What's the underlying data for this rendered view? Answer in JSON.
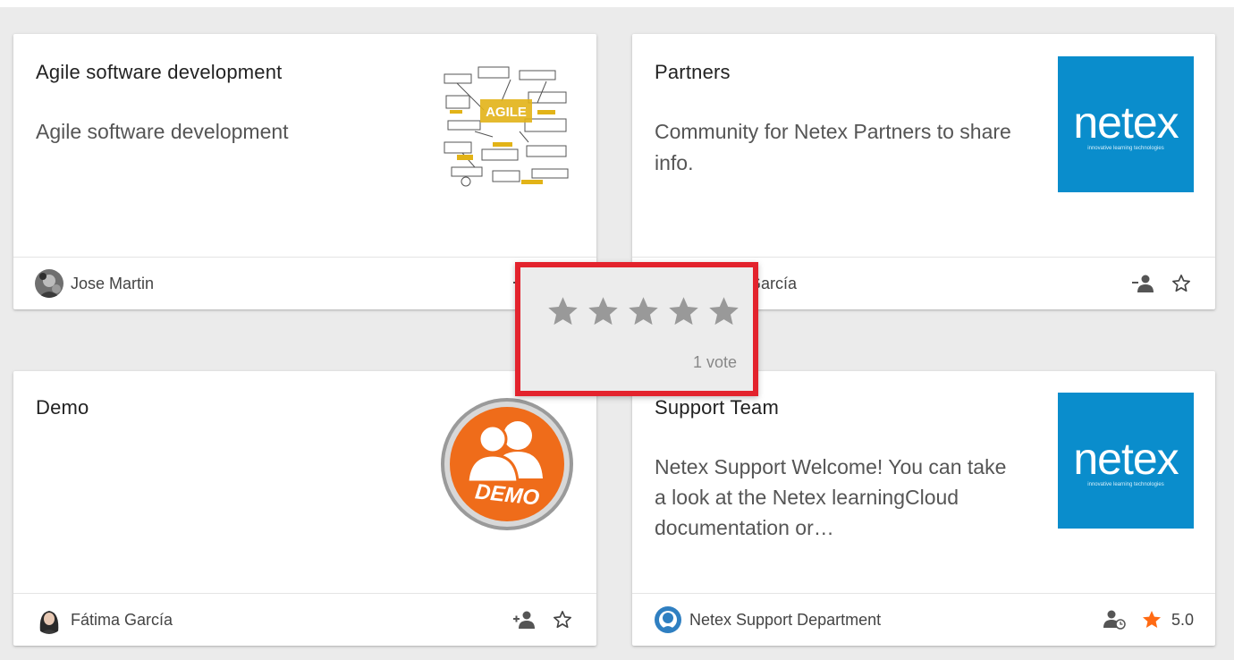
{
  "colors": {
    "accent_star": "#ff6a13",
    "popup_border": "#e3232d",
    "brand_blue": "#0a8dcc",
    "star_gray": "#999999"
  },
  "cards": [
    {
      "title": "Agile software development",
      "description": "Agile software development",
      "thumbnail": {
        "icon": "agile-sketch-image",
        "text": "AGILE"
      },
      "author": "Jose Martin",
      "join_icon": "add-person-icon",
      "favorite": false
    },
    {
      "title": "Partners",
      "description": "Community for Netex Partners to share info.",
      "thumbnail": {
        "icon": "netex-logo",
        "word": "netex",
        "tagline": "innovative learning technologies"
      },
      "author": "García",
      "join_icon": "remove-person-icon",
      "favorite": false
    },
    {
      "title": "Demo",
      "description": "",
      "thumbnail": {
        "icon": "demo-badge",
        "text": "DEMO"
      },
      "author": "Fátima García",
      "join_icon": "add-person-icon",
      "favorite": false
    },
    {
      "title": "Support Team",
      "description": "Netex Support Welcome! You can take a look at the Netex learningCloud documentation or…",
      "thumbnail": {
        "icon": "netex-logo",
        "word": "netex",
        "tagline": "innovative learning technologies"
      },
      "author": "Netex Support Department",
      "join_icon": "pending-person-icon",
      "favorite": true,
      "rating": "5.0"
    }
  ],
  "rating_popup": {
    "stars": 5,
    "votes_label": "1 vote"
  }
}
